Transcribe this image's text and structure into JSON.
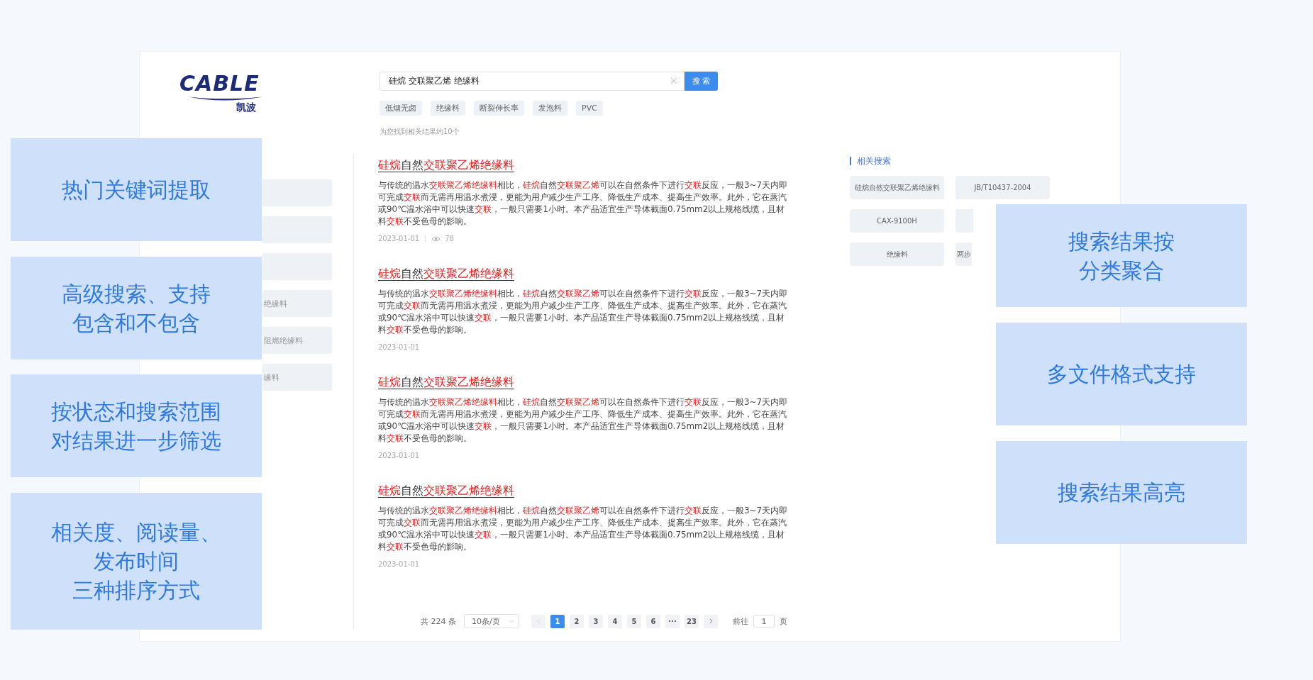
{
  "logo": {
    "text": "CABLE",
    "subtext": "凯波"
  },
  "search": {
    "value": "硅烷 交联聚乙烯 绝缘料",
    "button": "搜 索"
  },
  "hot_tags": [
    "低烟无卤",
    "绝缘料",
    "断裂伸长率",
    "发泡料",
    "PVC"
  ],
  "result_count": "为您找到相关结果约10个",
  "sidebar": {
    "items": [
      "绝缘料",
      "阻燃绝缘料",
      "缘料"
    ]
  },
  "results": [
    {
      "title": [
        {
          "t": "硅烷",
          "hl": true
        },
        {
          "t": "自然",
          "hl": false
        },
        {
          "t": "交联聚乙烯绝缘料",
          "hl": true
        }
      ],
      "body": [
        {
          "t": "与传统的温水",
          "hl": false
        },
        {
          "t": "交联聚乙烯绝缘料",
          "hl": true
        },
        {
          "t": "相比，",
          "hl": false
        },
        {
          "t": "硅烷",
          "hl": true
        },
        {
          "t": "自然",
          "hl": false
        },
        {
          "t": "交联聚乙烯",
          "hl": true
        },
        {
          "t": "可以在自然条件下进行",
          "hl": false
        },
        {
          "t": "交联",
          "hl": true
        },
        {
          "t": "反应，一般3~7天内即可完成",
          "hl": false
        },
        {
          "t": "交联",
          "hl": true
        },
        {
          "t": "而无需再用温水煮浸，更能为用户减少生产工序、降低生产成本、提高生产效率。此外，它在蒸汽或90℃温水浴中可以快速",
          "hl": false
        },
        {
          "t": "交联",
          "hl": true
        },
        {
          "t": "，一般只需要1小时。本产品适宜生产导体截面0.75mm2以上规格线缆，且材料",
          "hl": false
        },
        {
          "t": "交联",
          "hl": true
        },
        {
          "t": "不受色母的影响。",
          "hl": false
        }
      ],
      "date": "2023-01-01",
      "views": "78"
    },
    {
      "title": [
        {
          "t": "硅烷",
          "hl": true
        },
        {
          "t": "自然",
          "hl": false
        },
        {
          "t": "交联聚乙烯绝缘料",
          "hl": true
        }
      ],
      "body": [
        {
          "t": "与传统的温水",
          "hl": false
        },
        {
          "t": "交联聚乙烯绝缘料",
          "hl": true
        },
        {
          "t": "相比，",
          "hl": false
        },
        {
          "t": "硅烷",
          "hl": true
        },
        {
          "t": "自然",
          "hl": false
        },
        {
          "t": "交联聚乙烯",
          "hl": true
        },
        {
          "t": "可以在自然条件下进行",
          "hl": false
        },
        {
          "t": "交联",
          "hl": true
        },
        {
          "t": "反应，一般3~7天内即可完成",
          "hl": false
        },
        {
          "t": "交联",
          "hl": true
        },
        {
          "t": "而无需再用温水煮浸，更能为用户减少生产工序、降低生产成本、提高生产效率。此外，它在蒸汽或90℃温水浴中可以快速",
          "hl": false
        },
        {
          "t": "交联",
          "hl": true
        },
        {
          "t": "，一般只需要1小时。本产品适宜生产导体截面0.75mm2以上规格线缆，且材料",
          "hl": false
        },
        {
          "t": "交联",
          "hl": true
        },
        {
          "t": "不受色母的影响。",
          "hl": false
        }
      ],
      "date": "2023-01-01"
    },
    {
      "title": [
        {
          "t": "硅烷",
          "hl": true
        },
        {
          "t": "自然",
          "hl": false
        },
        {
          "t": "交联聚乙烯绝缘料",
          "hl": true
        }
      ],
      "body": [
        {
          "t": "与传统的温水",
          "hl": false
        },
        {
          "t": "交联聚乙烯绝缘料",
          "hl": true
        },
        {
          "t": "相比，",
          "hl": false
        },
        {
          "t": "硅烷",
          "hl": true
        },
        {
          "t": "自然",
          "hl": false
        },
        {
          "t": "交联聚乙烯",
          "hl": true
        },
        {
          "t": "可以在自然条件下进行",
          "hl": false
        },
        {
          "t": "交联",
          "hl": true
        },
        {
          "t": "反应，一般3~7天内即可完成",
          "hl": false
        },
        {
          "t": "交联",
          "hl": true
        },
        {
          "t": "而无需再用温水煮浸，更能为用户减少生产工序、降低生产成本、提高生产效率。此外，它在蒸汽或90℃温水浴中可以快速",
          "hl": false
        },
        {
          "t": "交联",
          "hl": true
        },
        {
          "t": "，一般只需要1小时。本产品适宜生产导体截面0.75mm2以上规格线缆，且材料",
          "hl": false
        },
        {
          "t": "交联",
          "hl": true
        },
        {
          "t": "不受色母的影响。",
          "hl": false
        }
      ],
      "date": "2023-01-01"
    },
    {
      "title": [
        {
          "t": "硅烷",
          "hl": true
        },
        {
          "t": "自然",
          "hl": false
        },
        {
          "t": "交联聚乙烯绝缘料",
          "hl": true
        }
      ],
      "body": [
        {
          "t": "与传统的温水",
          "hl": false
        },
        {
          "t": "交联聚乙烯绝缘料",
          "hl": true
        },
        {
          "t": "相比，",
          "hl": false
        },
        {
          "t": "硅烷",
          "hl": true
        },
        {
          "t": "自然",
          "hl": false
        },
        {
          "t": "交联聚乙烯",
          "hl": true
        },
        {
          "t": "可以在自然条件下进行",
          "hl": false
        },
        {
          "t": "交联",
          "hl": true
        },
        {
          "t": "反应，一般3~7天内即可完成",
          "hl": false
        },
        {
          "t": "交联",
          "hl": true
        },
        {
          "t": "而无需再用温水煮浸，更能为用户减少生产工序、降低生产成本、提高生产效率。此外，它在蒸汽或90℃温水浴中可以快速",
          "hl": false
        },
        {
          "t": "交联",
          "hl": true
        },
        {
          "t": "，一般只需要1小时。本产品适宜生产导体截面0.75mm2以上规格线缆，且材料",
          "hl": false
        },
        {
          "t": "交联",
          "hl": true
        },
        {
          "t": "不受色母的影响。",
          "hl": false
        }
      ],
      "date": "2023-01-01"
    }
  ],
  "pagination": {
    "total": "共 224 条",
    "page_size": "10条/页",
    "pages": [
      {
        "label": "1",
        "selected": true
      },
      {
        "label": "2",
        "selected": false
      },
      {
        "label": "3",
        "selected": false
      },
      {
        "label": "4",
        "selected": false
      },
      {
        "label": "5",
        "selected": false
      },
      {
        "label": "6",
        "selected": false
      },
      {
        "label": "···",
        "selected": false
      },
      {
        "label": "23",
        "selected": false
      }
    ],
    "goto_label": "前往",
    "goto_value": "1",
    "goto_unit": "页"
  },
  "related": {
    "title": "相关搜索",
    "items": [
      {
        "label": "硅烷自然交联聚乙烯绝缘料",
        "kind": "full"
      },
      {
        "label": "JB/T10437-2004",
        "kind": "full"
      },
      {
        "label": "CAX-9100H",
        "kind": "full"
      },
      {
        "label": "绝缘料",
        "kind": "full"
      },
      {
        "label": "两步",
        "kind": "partial"
      }
    ]
  },
  "callouts_left": [
    [
      "热门关键词提取"
    ],
    [
      "高级搜索、支持",
      "包含和不包含"
    ],
    [
      "按状态和搜索范围",
      "对结果进一步筛选"
    ],
    [
      "相关度、阅读量、",
      "发布时间",
      "三种排序方式"
    ]
  ],
  "callouts_right": [
    [
      "搜索结果按",
      "分类聚合"
    ],
    [
      "多文件格式支持"
    ],
    [
      "搜索结果高亮"
    ]
  ]
}
